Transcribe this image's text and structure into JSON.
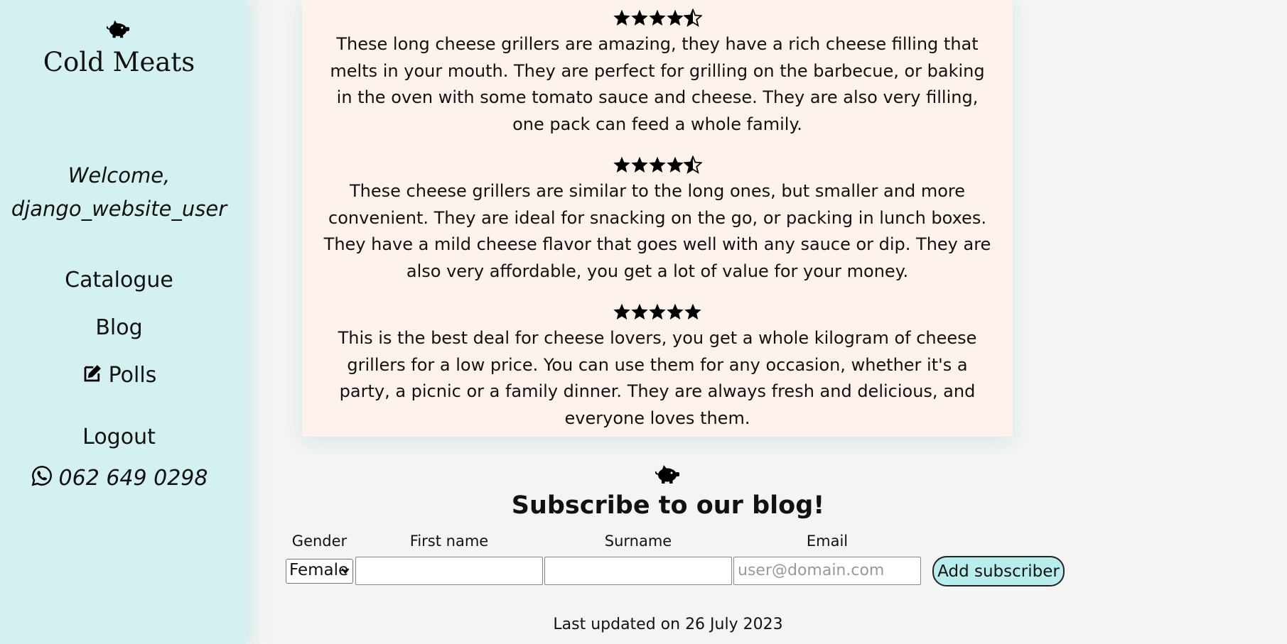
{
  "sidebar": {
    "brand": "Cold Meats",
    "logo_icon": "piggy-icon",
    "welcome_line1": "Welcome,",
    "welcome_line2": "django_website_user",
    "nav": {
      "catalogue": "Catalogue",
      "blog": "Blog",
      "polls": "Polls",
      "logout": "Logout"
    },
    "phone": "062 649 0298"
  },
  "reviews": [
    {
      "rating": 4.5,
      "text": "These long cheese grillers are amazing, they have a rich cheese filling that melts in your mouth. They are perfect for grilling on the barbecue, or baking in the oven with some tomato sauce and cheese. They are also very filling, one pack can feed a whole family."
    },
    {
      "rating": 4.5,
      "text": "These cheese grillers are similar to the long ones, but smaller and more convenient. They are ideal for snacking on the go, or packing in lunch boxes. They have a mild cheese flavor that goes well with any sauce or dip. They are also very affordable, you get a lot of value for your money."
    },
    {
      "rating": 5,
      "text": "This is the best deal for cheese lovers, you get a whole kilogram of cheese grillers for a low price. You can use them for any occasion, whether it's a party, a picnic or a family dinner. They are always fresh and delicious, and everyone loves them."
    }
  ],
  "subscribe": {
    "title": "Subscribe to our blog!",
    "gender_label": "Gender",
    "gender_value": "Female",
    "firstname_label": "First name",
    "surname_label": "Surname",
    "email_label": "Email",
    "email_placeholder": "user@domain.com",
    "button": "Add subscriber"
  },
  "footer": {
    "updated": "Last updated on 26 July 2023"
  },
  "colors": {
    "sidebar": "#d3f1f0",
    "card": "#fdf2ec",
    "button": "#b8eded",
    "page": "#f4f4f4"
  }
}
